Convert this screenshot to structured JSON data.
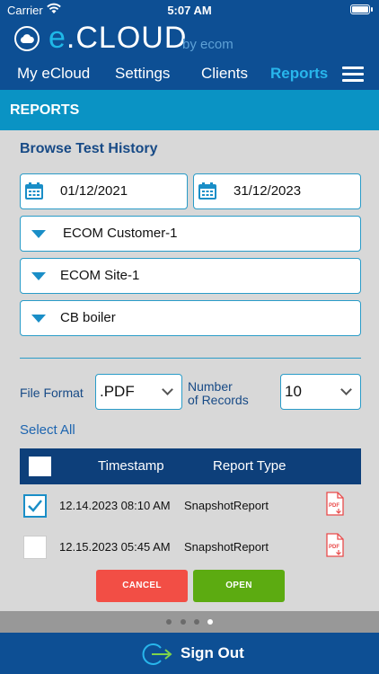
{
  "status_bar": {
    "carrier": "Carrier",
    "time": "5:07 AM"
  },
  "header": {
    "logo_e": "e",
    "logo_text": ".CLOUD",
    "logo_by": "by ecom",
    "nav": [
      {
        "label": "My eCloud",
        "active": false
      },
      {
        "label": "Settings",
        "active": false
      },
      {
        "label": "Clients",
        "active": false
      },
      {
        "label": "Reports",
        "active": true
      }
    ],
    "menu_icon": "hamburger-icon"
  },
  "page_title": "REPORTS",
  "browse": {
    "title": "Browse Test History",
    "date_from": "01/12/2021",
    "date_to": "31/12/2023",
    "customer": "ECOM Customer-1",
    "site": "ECOM Site-1",
    "equipment": "CB boiler"
  },
  "options": {
    "file_format_label": "File Format",
    "file_format_value": ".PDF",
    "records_label_line1": "Number",
    "records_label_line2": "of Records",
    "records_value": "10"
  },
  "select_all": "Select All",
  "table": {
    "headers": {
      "timestamp": "Timestamp",
      "report_type": "Report Type"
    },
    "rows": [
      {
        "checked": true,
        "timestamp": "12.14.2023 08:10 AM",
        "report_type": "SnapshotReport"
      },
      {
        "checked": false,
        "timestamp": "12.15.2023 05:45 AM",
        "report_type": "SnapshotReport"
      }
    ]
  },
  "buttons": {
    "cancel": "CANCEL",
    "open": "OPEN"
  },
  "pager": {
    "count": 4,
    "active_index": 3
  },
  "footer": {
    "sign_out": "Sign Out"
  },
  "colors": {
    "header_blue": "#0d4f94",
    "title_cyan": "#0a93c4",
    "accent": "#28b6ec",
    "cancel_red": "#f24e45",
    "open_green": "#5cab11",
    "table_header": "#0d3f7a"
  }
}
